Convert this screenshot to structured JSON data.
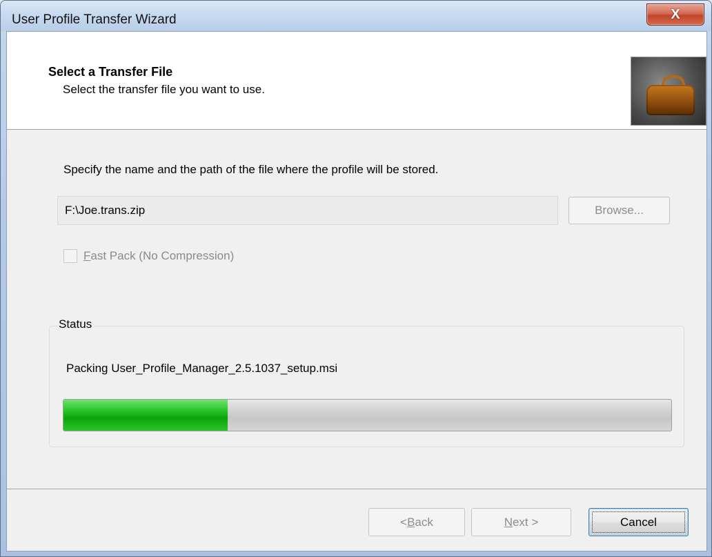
{
  "window": {
    "title": "User Profile Transfer Wizard",
    "close_glyph": "X"
  },
  "header": {
    "title": "Select a Transfer File",
    "subtitle": "Select the transfer file you want to use.",
    "image_icon": "luggage-bag-icon"
  },
  "body": {
    "instructions": "Specify the name and the path of the file where the profile will be stored.",
    "path_value": "F:\\Joe.trans.zip",
    "browse_label": "Browse...",
    "fastpack": {
      "mnemonic": "F",
      "rest": "ast Pack (No Compression)",
      "checked": false,
      "enabled": false
    }
  },
  "status": {
    "legend": "Status",
    "message": "Packing User_Profile_Manager_2.5.1037_setup.msi",
    "progress_percent": 27
  },
  "footer": {
    "back": {
      "prefix": "< ",
      "mnemonic": "B",
      "rest": "ack"
    },
    "next": {
      "mnemonic": "N",
      "rest": "ext >"
    },
    "cancel": "Cancel"
  },
  "colors": {
    "progress_green": "#20c020",
    "close_red": "#c2442a"
  }
}
